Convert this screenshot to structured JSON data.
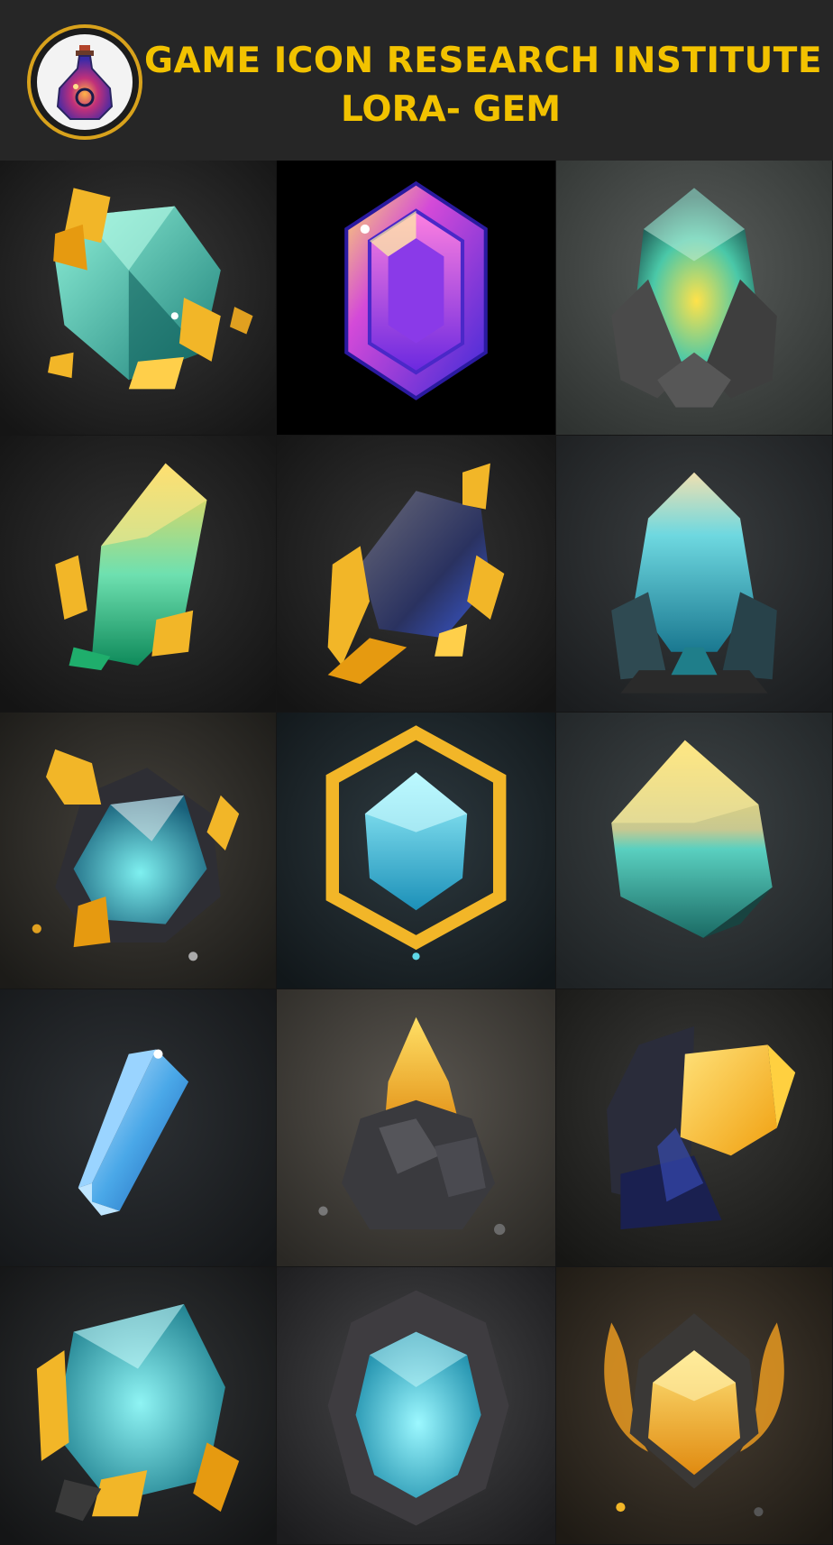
{
  "header": {
    "title": "GAME ICON RESEARCH INSTITUTE",
    "subtitle": "LORA- GEM",
    "logo_icon": "potion-bottle-icon"
  },
  "colors": {
    "title": "#f2c200",
    "logo_ring": "#d8a21c",
    "gold": "#f2b628",
    "teal": "#3cc8c0",
    "cyan": "#5fd8e8",
    "violet": "#7a3cf0",
    "rock": "#3a3a40"
  },
  "gems": [
    {
      "icon": "teal-gem-gold-shards-icon"
    },
    {
      "icon": "purple-hexagonal-gem-icon"
    },
    {
      "icon": "glowing-teal-crystal-in-rock-icon"
    },
    {
      "icon": "green-gold-crystal-shard-icon"
    },
    {
      "icon": "dark-blue-gem-gold-shards-icon"
    },
    {
      "icon": "cyan-crystal-cluster-icon"
    },
    {
      "icon": "cyan-gem-in-gold-leaves-rock-icon"
    },
    {
      "icon": "cyan-gem-gold-hexagon-frame-icon"
    },
    {
      "icon": "teal-gold-faceted-crystal-icon"
    },
    {
      "icon": "blue-crystal-prism-icon"
    },
    {
      "icon": "gold-crystal-on-rock-icon"
    },
    {
      "icon": "gold-dark-crystal-burst-icon"
    },
    {
      "icon": "teal-gem-gold-shards-large-icon"
    },
    {
      "icon": "cyan-gem-in-stone-icon"
    },
    {
      "icon": "gold-gem-in-flames-icon"
    }
  ]
}
